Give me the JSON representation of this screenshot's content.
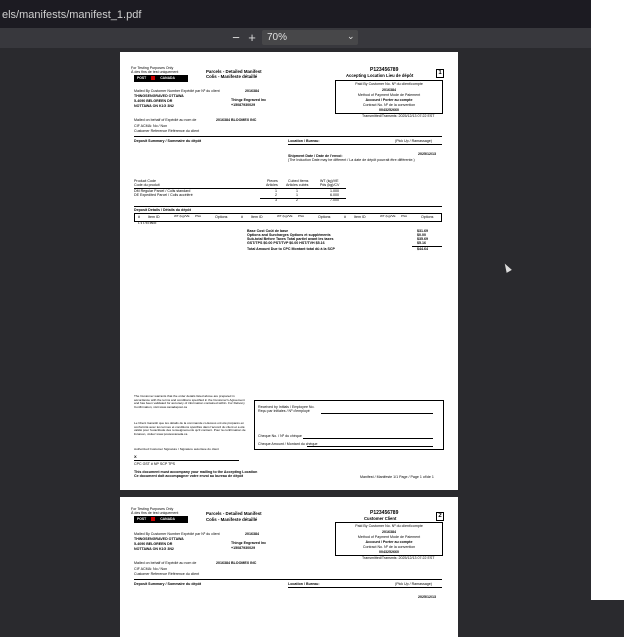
{
  "browser": {
    "url_text": "els/manifests/manifest_1.pdf"
  },
  "toolbar": {
    "zoom_out_label": "−",
    "zoom_in_label": "+",
    "zoom_value": "70%"
  },
  "page1": {
    "testing_en": "For Testing Purposes Only",
    "testing_fr": "À des fins de test uniquement",
    "logo_left": "POST",
    "logo_right": "CANADA",
    "title_en": "Parcels - Detailed Manifest",
    "title_fr": "Colis - Manifeste détaillé",
    "manifest_number": "P123456789",
    "location_label": "Accepting Location   Lieu de dépôt",
    "page_badge": "1",
    "paid_by_label": "Paid By Customer No. Nº du client/compte",
    "paid_by_value": "2016384",
    "payment_method_label": "Method of Payment Mode de Paiement",
    "payment_method_value": "Account / Porter au compte",
    "contract_label": "Contract No. Nº de la convention",
    "contract_value": "0043252660",
    "transmitted": "Transmitted/Transmis: 2025/12/13 07:22 EST",
    "mailed_by_label": "Mailed By Customer Number   Expédié par Nº du client",
    "mailed_by_value": "2016384",
    "company": "Thingz Engraved Inc",
    "address1": "THINGSENGRAVED OTTAWA",
    "address2": "5-4090 BELGREEN DR",
    "address3": "NOTTAWA ON K1G 3N2",
    "phone": "+15087930029",
    "behalf_label": "Mailed on behalf of   Expédié au nom de",
    "behalf_value": "2016384 BLOOMEX INC",
    "cif_line": "CIF ACMA:   No / Non",
    "ref_line": "Customer Reference   Référence du client",
    "deposit_summary": "Deposit Summary / Sommaire du dépôt",
    "location_bureau": "Location / Bureau:",
    "pickup": "(Pick Up / Ramassage)",
    "ship_date_label": "Shipment Date / Date de l'envoi:",
    "ship_date_value": "2025/12/13",
    "induction_note": "(The Induction Date may be different / La date de dépôt pourrait être différente.)",
    "product_code_label": "Product Code",
    "product_code_fr": "Code du produit",
    "pieces_label": "Pieces",
    "pieces_fr": "Articles",
    "cubed_label": "Cubed Items",
    "cubed_fr": "Articles cubés",
    "weight_label": "WT (kg)/VE",
    "weight_fr": "Pds (kg)/CV",
    "product_rows": [
      {
        "name": "DM Regular Parcel / Colis standard",
        "pieces": "1",
        "cubed": "1",
        "weight": "1.000"
      },
      {
        "name": "DE Expedited Parcel / Colis accéléré",
        "pieces": "2",
        "cubed": "1",
        "weight": "6.000"
      }
    ],
    "product_totals": {
      "pieces": "3",
      "cubed": "2",
      "weight": "7.000"
    },
    "deposit_details": "Deposit Details / Détails du dépôt",
    "detail_headers": [
      "#",
      "Item ID",
      "WT (kg)/VE",
      "PSA",
      "Options"
    ],
    "detail_row": "1   3 1 53   IBDF",
    "charges": [
      {
        "label": "Base Cost   Coût de base",
        "value": "$31.69"
      },
      {
        "label": "Options and Surcharges   Options et suppléments",
        "value": "$0.00"
      },
      {
        "label": "Sub-total Before Taxes   Total partiel avant les taxes",
        "value": "$35.69"
      },
      {
        "label": "GST/TPS $0.00 PST/TVP $0.00 HST/TVH $5.16",
        "value": "$5.16"
      }
    ],
    "total_label": "Total Amount Due to CPC   Montant total dû à la SCP",
    "total_value": "$44.64",
    "warrant_en": "The Customer warrants that the order details listed above are prepared in accordance with the terms and conditions specified in the Customer's Agreement and has been validated for accuracy of information contained within. For Delivery Confirmation, visit www.canadapost.ca",
    "warrant_fr": "Le Client Garantit que les détails de la commande ci-dessus ont été préparés en conformité avec les termes et conditions spécifiés dans l'accord du client et a été validé pour l'exactitude des renseignements qu'il contient. Pour la confirmation de livraison, visitez www.postescanada.ca",
    "received_label": "Received by Initials / Employee No.",
    "received_fr": "Reçu par initiales / Nº d'employé",
    "cheque_no": "Cheque No. / Nº du chèque",
    "cheque_amt": "Cheque Amount / Montant du chèque",
    "signature_label": "Authorized Customer Signature / Signature autorisée du client",
    "signature_x": "X",
    "gst_line": "CPC GST # NP SCP TPS",
    "accompany_en": "This document must accompany your mailing to the Accepting Location",
    "accompany_fr": "Ce document doit accompagner votre envoi au bureau de dépôt",
    "footer": "Manifest / Manifeste 1/1 Page / Page 1 of/de 1"
  },
  "page2": {
    "testing_en": "For Testing Purposes Only",
    "testing_fr": "À des fins de test uniquement",
    "manifest_number": "P123456789",
    "location_label": "Customer   Client",
    "page_badge": "2",
    "title_en": "Parcels - Detailed Manifest",
    "title_fr": "Colis - Manifeste détaillé",
    "deposit_summary": "Deposit Summary / Sommaire du dépôt",
    "location_bureau": "Location / Bureau:",
    "pickup": "(Pick Up / Ramassage)",
    "ship_date_value": "2025/12/13"
  }
}
